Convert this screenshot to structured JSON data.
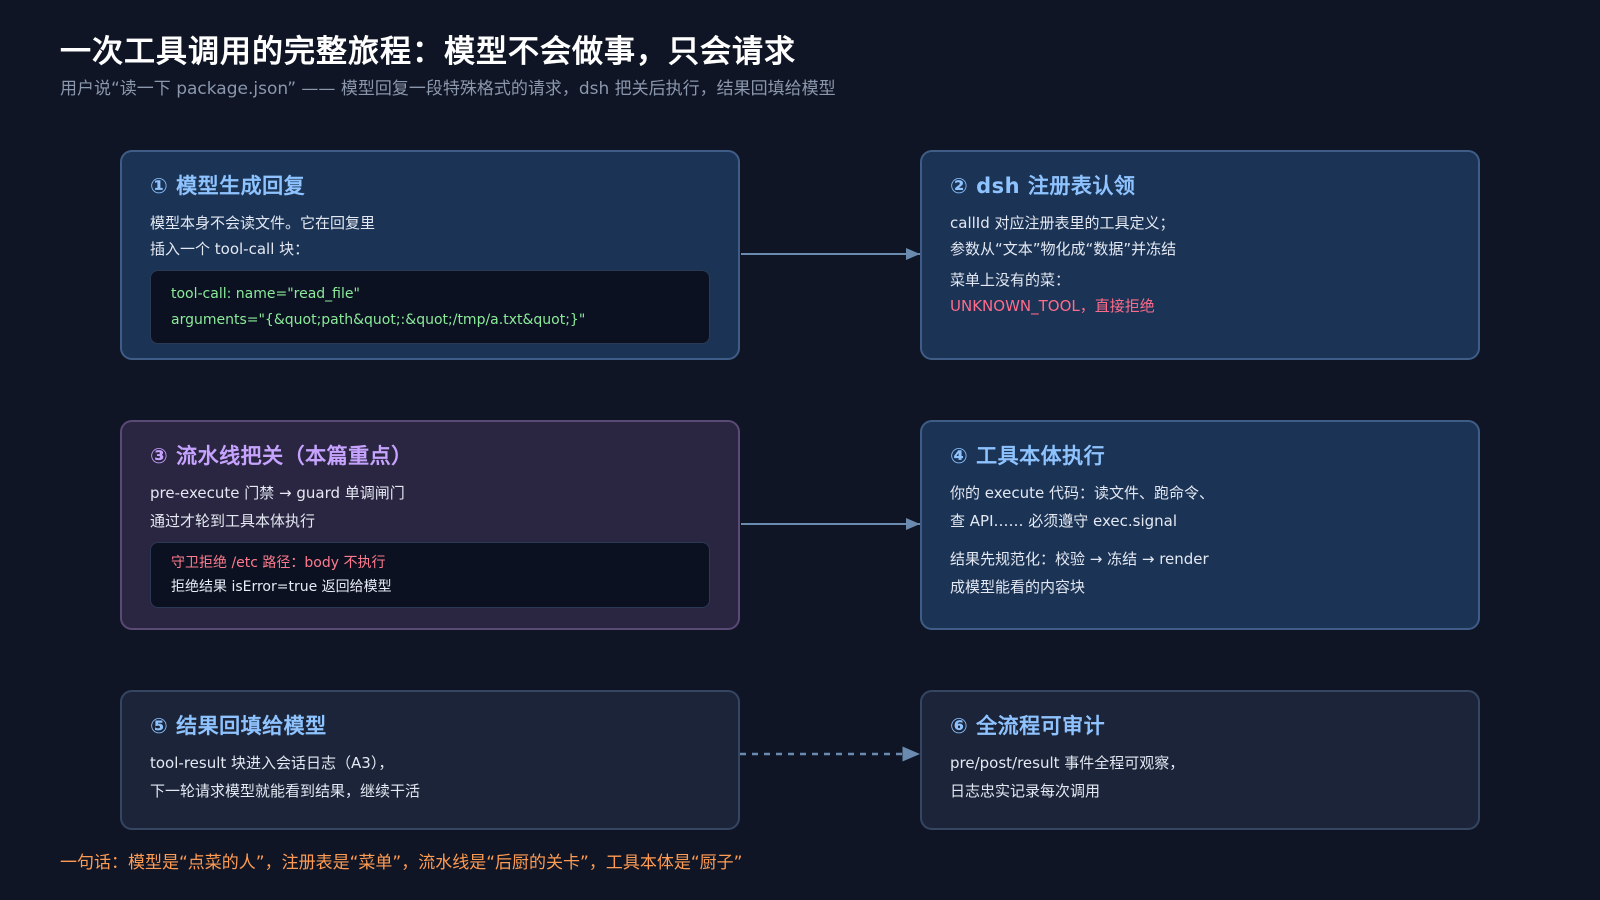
{
  "title": "一次工具调用的完整旅程：模型不会做事，只会请求",
  "subtitle": "用户说“读一下 package.json” —— 模型回复一段特殊格式的请求，dsh 把关后执行，结果回填给模型",
  "cards": [
    {
      "title": "① 模型生成回复",
      "lines": [
        "模型本身不会读文件。它在回复里",
        "插入一个 tool-call 块："
      ],
      "code": [
        "tool-call: name=\"read_file\"",
        "arguments=\"{&quot;path&quot;:&quot;/tmp/a.txt&quot;}\""
      ]
    },
    {
      "title": "② dsh 注册表认领",
      "lines": [
        "callId 对应注册表里的工具定义；",
        "参数从“文本”物化成“数据”并冻结",
        "菜单上没有的菜：",
        "UNKNOWN_TOOL，直接拒绝"
      ]
    },
    {
      "title": "③ 流水线把关（本篇重点）",
      "lines": [
        "pre-execute 门禁 → guard 单调闸门",
        "通过才轮到工具本体执行"
      ],
      "code": [
        "守卫拒绝 /etc 路径：body 不执行",
        "拒绝结果 isError=true 返回给模型"
      ]
    },
    {
      "title": "④ 工具本体执行",
      "lines": [
        "你的 execute 代码：读文件、跑命令、",
        "查 API…… 必须遵守 exec.signal",
        "结果先规范化：校验 → 冻结 → render",
        "成模型能看的内容块"
      ]
    },
    {
      "title": "⑤ 结果回填给模型",
      "lines": [
        "tool-result 块进入会话日志（A3），",
        "下一轮请求模型就能看到结果，继续干活"
      ]
    },
    {
      "title": "⑥ 全流程可审计",
      "lines": [
        "pre/post/result 事件全程可观察，",
        "日志忠实记录每次调用"
      ]
    }
  ],
  "footer": "一句话：模型是“点菜的人”，注册表是“菜单”，流水线是“后厨的关卡”，工具本体是“厨子”",
  "colors": {
    "background": "#0f1524",
    "accent_blue": "#8ec3ff",
    "accent_purple": "#c6a3ff",
    "code_green": "#8bea9a",
    "danger": "#ff6b8b",
    "footer": "#ff9b52"
  }
}
